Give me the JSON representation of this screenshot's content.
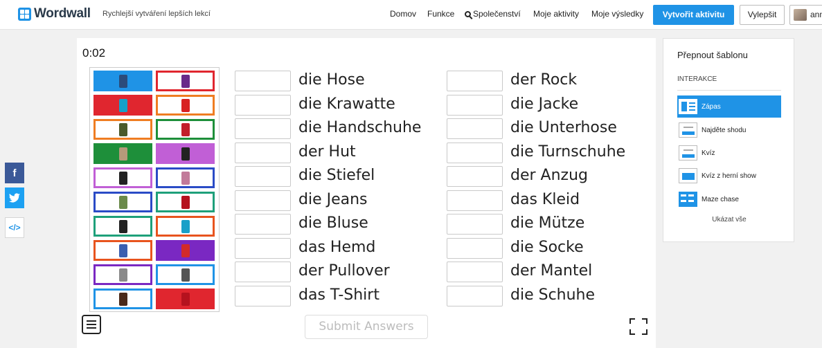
{
  "header": {
    "logo": "Wordwall",
    "tagline": "Rychlejší vytváření lepších lekcí",
    "nav": [
      "Domov",
      "Funkce",
      "Společenství",
      "Moje aktivity",
      "Moje výsledky"
    ],
    "create_label": "Vytvořit aktivitu",
    "upgrade_label": "Vylepšit",
    "user_label": "ann"
  },
  "social": {
    "facebook": "f",
    "twitter": "t",
    "embed": "</>"
  },
  "game": {
    "timer": "0:02",
    "submit_label": "Submit Answers",
    "left_words": [
      "die Hose",
      "die Krawatte",
      "die Handschuhe",
      "der Hut",
      "die Stiefel",
      "die Jeans",
      "die Bluse",
      "das Hemd",
      "der Pullover",
      "das T-Shirt"
    ],
    "right_words": [
      "der Rock",
      "die Jacke",
      "die Unterhose",
      "die Turnschuhe",
      "der Anzug",
      "das Kleid",
      "die Mütze",
      "die Socke",
      "der Mantel",
      "die Schuhe"
    ],
    "tiles": [
      {
        "border": "#1f93e6",
        "fill": "#1f93e6",
        "pic": "#2c4b7a"
      },
      {
        "border": "#e0262f",
        "fill": "#ffffff",
        "pic": "#6a2a8a"
      },
      {
        "border": "#e0262f",
        "fill": "#e0262f",
        "pic": "#17a0c8"
      },
      {
        "border": "#ef7d22",
        "fill": "#ffffff",
        "pic": "#d82222"
      },
      {
        "border": "#ef7d22",
        "fill": "#ffffff",
        "pic": "#4a5a2a"
      },
      {
        "border": "#1e8f3a",
        "fill": "#ffffff",
        "pic": "#c21e2a"
      },
      {
        "border": "#1e8f3a",
        "fill": "#1e8f3a",
        "pic": "#b59a7a"
      },
      {
        "border": "#c15fd6",
        "fill": "#c15fd6",
        "pic": "#222222"
      },
      {
        "border": "#c15fd6",
        "fill": "#ffffff",
        "pic": "#222222"
      },
      {
        "border": "#2a4bc6",
        "fill": "#ffffff",
        "pic": "#c27a9a"
      },
      {
        "border": "#2a4bc6",
        "fill": "#ffffff",
        "pic": "#6a8a4a"
      },
      {
        "border": "#1ea07a",
        "fill": "#ffffff",
        "pic": "#b5121e"
      },
      {
        "border": "#1ea07a",
        "fill": "#ffffff",
        "pic": "#222222"
      },
      {
        "border": "#e8541e",
        "fill": "#ffffff",
        "pic": "#1aa0c8"
      },
      {
        "border": "#e8541e",
        "fill": "#ffffff",
        "pic": "#3a5fb0"
      },
      {
        "border": "#7a28c2",
        "fill": "#7a28c2",
        "pic": "#d22a2a"
      },
      {
        "border": "#7a28c2",
        "fill": "#ffffff",
        "pic": "#8a8a8a"
      },
      {
        "border": "#1f93e6",
        "fill": "#ffffff",
        "pic": "#555555"
      },
      {
        "border": "#1f93e6",
        "fill": "#ffffff",
        "pic": "#4a2a1a"
      },
      {
        "border": "#e0262f",
        "fill": "#e0262f",
        "pic": "#b5121e"
      }
    ]
  },
  "sidebar": {
    "title": "Přepnout šablonu",
    "section": "INTERAKCE",
    "templates": [
      "Zápas",
      "Najděte shodu",
      "Kvíz",
      "Kvíz z herní show",
      "Maze chase"
    ],
    "show_all": "Ukázat vše"
  }
}
